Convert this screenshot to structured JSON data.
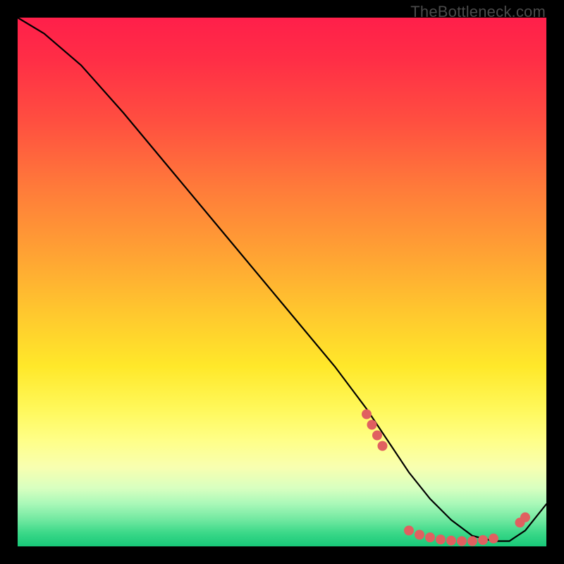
{
  "watermark": "TheBottleneck.com",
  "chart_data": {
    "type": "line",
    "title": "",
    "xlabel": "",
    "ylabel": "",
    "xlim": [
      0,
      100
    ],
    "ylim": [
      0,
      100
    ],
    "grid": false,
    "series": [
      {
        "name": "curve",
        "color": "#000000",
        "x": [
          0,
          5,
          12,
          20,
          30,
          40,
          50,
          60,
          66,
          70,
          74,
          78,
          82,
          86,
          90,
          93,
          96,
          100
        ],
        "y": [
          100,
          97,
          91,
          82,
          70,
          58,
          46,
          34,
          26,
          20,
          14,
          9,
          5,
          2,
          1,
          1,
          3,
          8
        ]
      }
    ],
    "markers": [
      {
        "name": "optimum-cluster",
        "color": "#e06060",
        "radius_px": 7,
        "points": [
          {
            "x": 66,
            "y": 25
          },
          {
            "x": 67,
            "y": 23
          },
          {
            "x": 68,
            "y": 21
          },
          {
            "x": 69,
            "y": 19
          },
          {
            "x": 74,
            "y": 3
          },
          {
            "x": 76,
            "y": 2.2
          },
          {
            "x": 78,
            "y": 1.7
          },
          {
            "x": 80,
            "y": 1.3
          },
          {
            "x": 82,
            "y": 1.1
          },
          {
            "x": 84,
            "y": 1.0
          },
          {
            "x": 86,
            "y": 1.0
          },
          {
            "x": 88,
            "y": 1.2
          },
          {
            "x": 90,
            "y": 1.5
          },
          {
            "x": 95,
            "y": 4.5
          },
          {
            "x": 96,
            "y": 5.5
          }
        ]
      }
    ]
  }
}
